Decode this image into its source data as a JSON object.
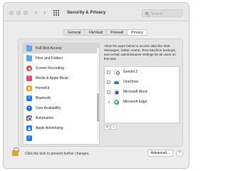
{
  "window": {
    "title": "Security & Privacy",
    "back_glyph": "‹",
    "forward_glyph": "›",
    "search_placeholder": "Search"
  },
  "tabs": [
    {
      "label": "General",
      "active": false
    },
    {
      "label": "FileVault",
      "active": false
    },
    {
      "label": "Firewall",
      "active": false
    },
    {
      "label": "Privacy",
      "active": true
    }
  ],
  "sidebar": {
    "items": [
      {
        "label": "Full Disk Access",
        "icon": "folder-icon",
        "selected": true
      },
      {
        "label": "Files and Folders",
        "icon": "folder-icon",
        "selected": false
      },
      {
        "label": "Screen Recording",
        "icon": "screen-recording-icon",
        "selected": false
      },
      {
        "label": "Media & Apple Music",
        "icon": "music-icon",
        "selected": false
      },
      {
        "label": "HomeKit",
        "icon": "home-icon",
        "selected": false
      },
      {
        "label": "Bluetooth",
        "icon": "bluetooth-icon",
        "selected": false
      },
      {
        "label": "User Availability",
        "icon": "user-availability-icon",
        "selected": false
      },
      {
        "label": "Automation",
        "icon": "automation-icon",
        "selected": false
      },
      {
        "label": "Apple Advertising",
        "icon": "advertising-icon",
        "selected": false
      }
    ]
  },
  "main": {
    "description": "Allow the apps below to access data like Mail, Messages, Safari, Home, Time Machine backups, and certain administrative settings for all users on this Mac.",
    "apps": [
      {
        "name": "Gemini 2",
        "checked": false,
        "icon": "gemini-icon"
      },
      {
        "name": "OneDrive",
        "checked": false,
        "icon": "onedrive-icon"
      },
      {
        "name": "Microsoft Word",
        "checked": false,
        "icon": "word-icon"
      },
      {
        "name": "Microsoft Edge",
        "checked": true,
        "icon": "edge-icon"
      }
    ],
    "add_label": "+",
    "remove_label": "−"
  },
  "footer": {
    "lock_text": "Click the lock to prevent further changes.",
    "advanced_label": "Advanced...",
    "help_label": "?"
  },
  "colors": {
    "window_bg": "#ececec",
    "selected_row": "#d6d6d6",
    "lock": "#e0a53b"
  }
}
